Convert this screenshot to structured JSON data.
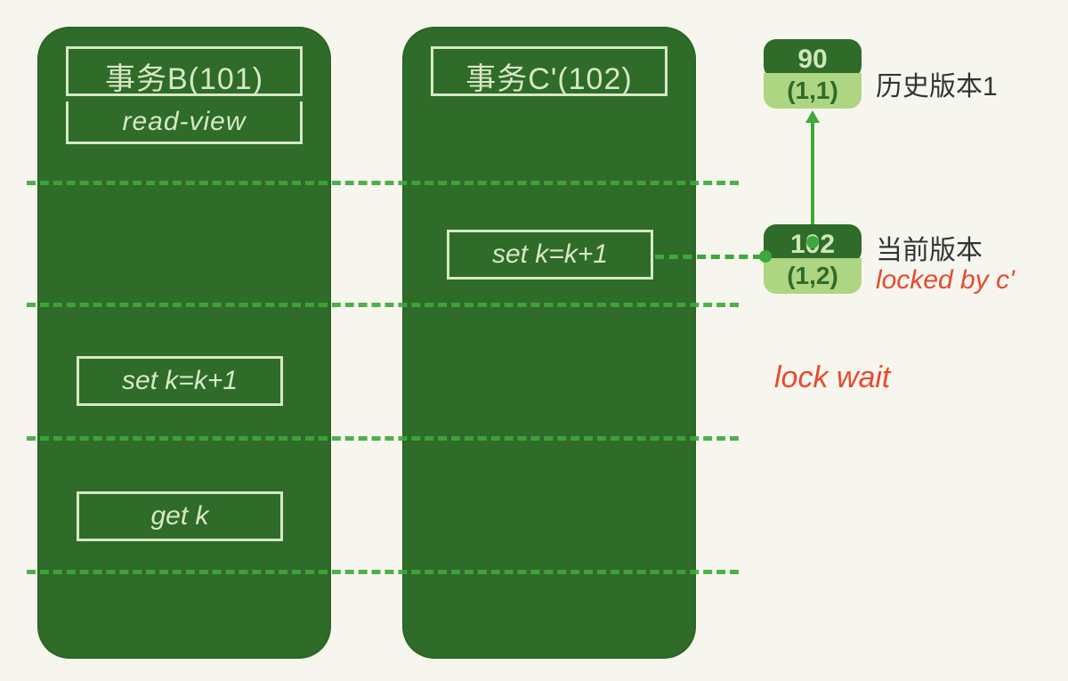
{
  "transactions": {
    "B": {
      "title": "事务B(101)",
      "readview": "read-view",
      "ops": {
        "set": "set k=k+1",
        "get": "get k"
      }
    },
    "C": {
      "title": "事务C'(102)",
      "ops": {
        "set": "set k=k+1"
      }
    }
  },
  "versions": {
    "v1": {
      "txid": "90",
      "row": "(1,1)",
      "label": "历史版本1"
    },
    "v2": {
      "txid": "102",
      "row": "(1,2)",
      "label": "当前版本",
      "lock": "locked by c'"
    }
  },
  "annotations": {
    "lock_wait": "lock wait"
  }
}
